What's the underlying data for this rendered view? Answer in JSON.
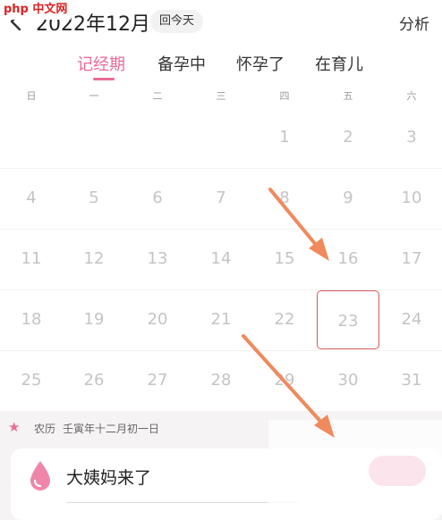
{
  "watermark": "php 中文网",
  "header": {
    "title": "2022年12月",
    "today_label": "回今天",
    "analysis_label": "分析"
  },
  "tabs": [
    {
      "label": "记经期",
      "active": true
    },
    {
      "label": "备孕中",
      "active": false
    },
    {
      "label": "怀孕了",
      "active": false
    },
    {
      "label": "在育儿",
      "active": false
    }
  ],
  "weekdays": [
    "日",
    "一",
    "二",
    "三",
    "四",
    "五",
    "六"
  ],
  "calendar": {
    "rows": [
      [
        "",
        "",
        "",
        "",
        "1",
        "2",
        "3"
      ],
      [
        "4",
        "5",
        "6",
        "7",
        "8",
        "9",
        "10"
      ],
      [
        "11",
        "12",
        "13",
        "14",
        "15",
        "16",
        "17"
      ],
      [
        "18",
        "19",
        "20",
        "21",
        "22",
        "23",
        "24"
      ],
      [
        "25",
        "26",
        "27",
        "28",
        "29",
        "30",
        "31"
      ]
    ],
    "selected_day": "23"
  },
  "lunar": {
    "label": "农历",
    "text": "壬寅年十二月初一日"
  },
  "period_card": {
    "label": "大姨妈来了"
  },
  "colors": {
    "accent": "#e96b94",
    "selected_border": "#d45a5a",
    "annotation_arrow": "#ef8a5c"
  },
  "icons": {
    "back": "chevron-left-icon",
    "star": "star-icon",
    "drop": "blood-drop-icon"
  }
}
